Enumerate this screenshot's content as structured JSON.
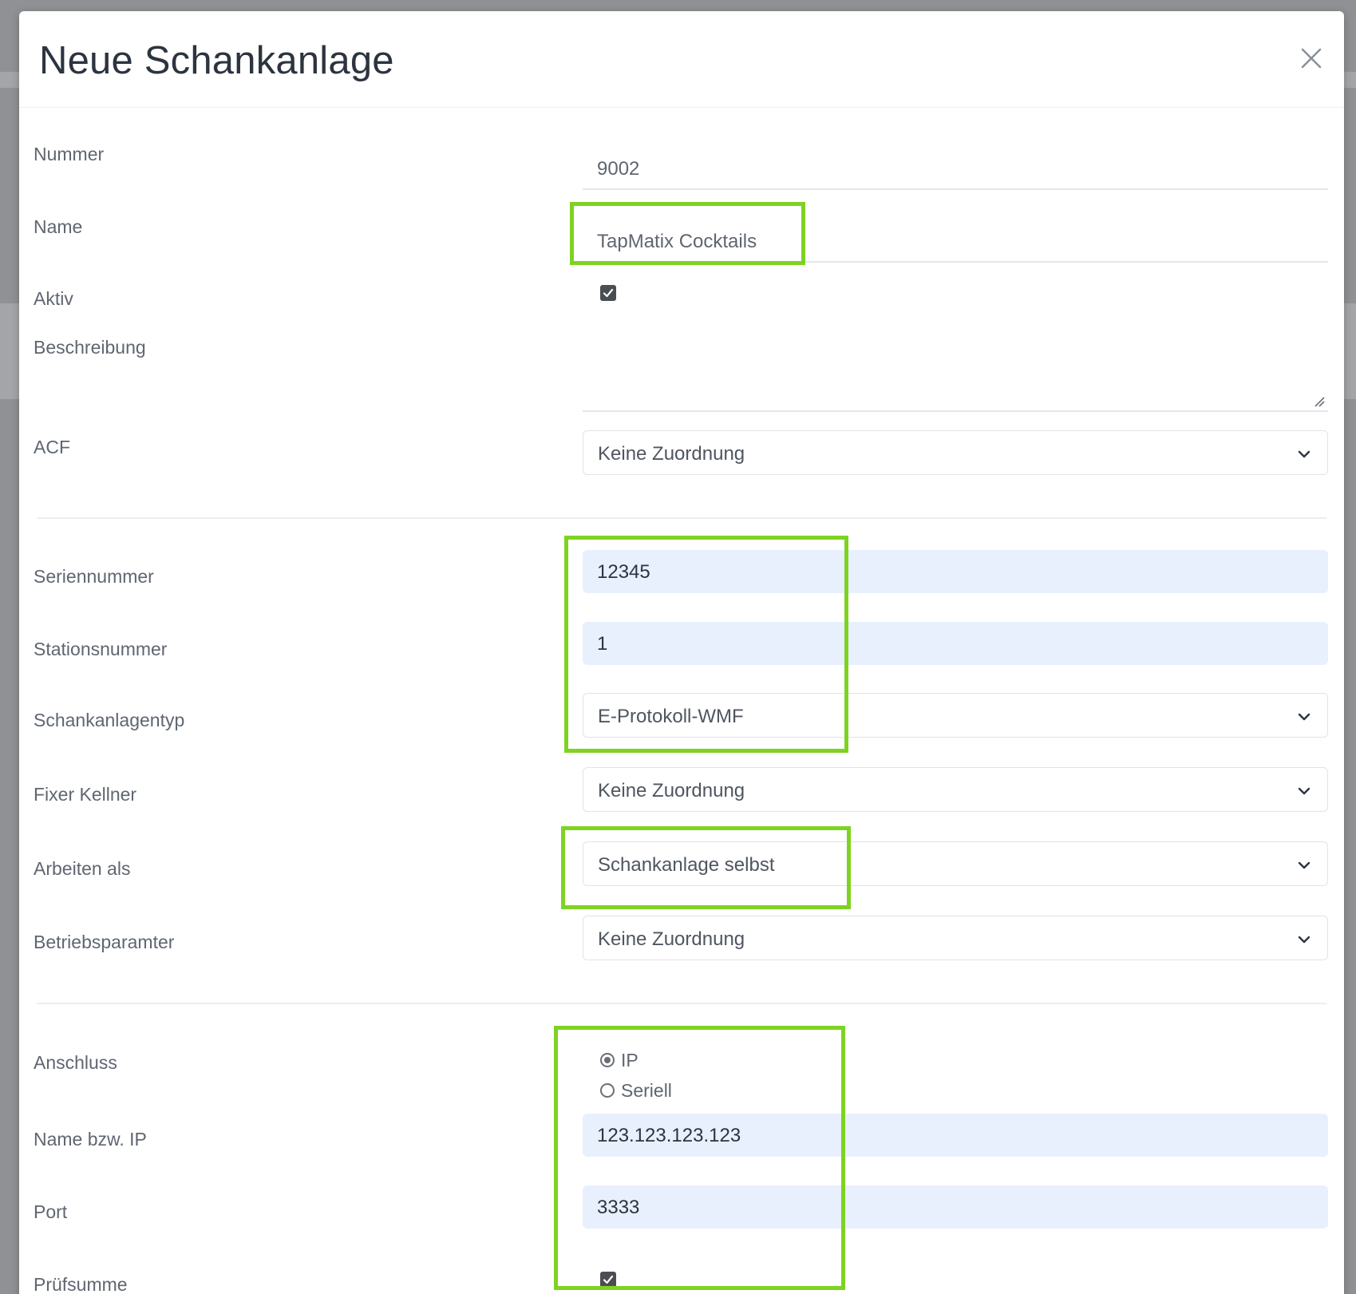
{
  "dialog": {
    "title": "Neue Schankanlage",
    "close_icon": "close-icon"
  },
  "fields": {
    "nummer": {
      "label": "Nummer",
      "value": "9002"
    },
    "name": {
      "label": "Name",
      "value": "TapMatix Cocktails"
    },
    "aktiv": {
      "label": "Aktiv",
      "checked": true
    },
    "beschreibung": {
      "label": "Beschreibung",
      "value": ""
    },
    "acf": {
      "label": "ACF",
      "selected": "Keine Zuordnung"
    },
    "seriennummer": {
      "label": "Seriennummer",
      "value": "12345"
    },
    "stationsnummer": {
      "label": "Stationsnummer",
      "value": "1"
    },
    "schankanlagentyp": {
      "label": "Schankanlagentyp",
      "selected": "E-Protokoll-WMF"
    },
    "fixer_kellner": {
      "label": "Fixer Kellner",
      "selected": "Keine Zuordnung"
    },
    "arbeiten_als": {
      "label": "Arbeiten als",
      "selected": "Schankanlage selbst"
    },
    "betriebsparamter": {
      "label": "Betriebsparamter",
      "selected": "Keine Zuordnung"
    },
    "anschluss": {
      "label": "Anschluss",
      "options": [
        "IP",
        "Seriell"
      ],
      "selected": "IP"
    },
    "name_bzw_ip": {
      "label": "Name bzw. IP",
      "value": "123.123.123.123"
    },
    "port": {
      "label": "Port",
      "value": "3333"
    },
    "pruefsumme": {
      "label": "Prüfsumme",
      "checked": true
    }
  },
  "colors": {
    "highlight": "#7ed321",
    "autofill_bg": "#e8f0fe",
    "title": "#2c3440"
  }
}
